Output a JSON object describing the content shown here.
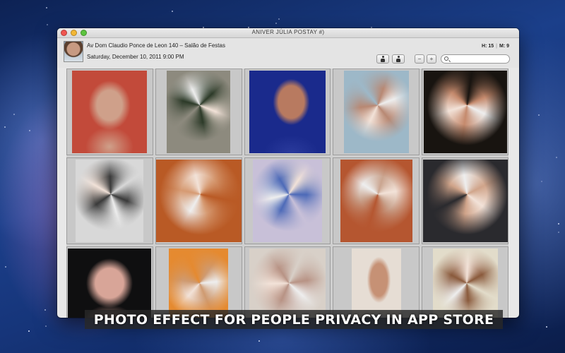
{
  "window": {
    "title": "ANIVER JÚLIA POSTAY #)"
  },
  "header": {
    "address": "Av Dom Claudio Ponce de Leon 140 – Salão de Festas",
    "date": "Saturday, December 10, 2011 9:00 PM",
    "h_count": "H: 15",
    "m_count": "M: 9",
    "separator": "|",
    "minus_label": "−",
    "plus_label": "+",
    "search_value": ""
  },
  "banner": {
    "text": "PHOTO EFFECT FOR PEOPLE PRIVACY IN APP STORE"
  },
  "photos": [
    {
      "style": "blur-face",
      "bg": "#c24a3a",
      "skin": "#cfa08a"
    },
    {
      "style": "swirl",
      "bg": "#8d8a7e",
      "skin": "#2c3a28"
    },
    {
      "style": "clear",
      "bg": "#1a2a8c",
      "skin": "#b87a60"
    },
    {
      "style": "swirl",
      "bg": "#9db8c8",
      "skin": "#b88873"
    },
    {
      "style": "swirl",
      "bg": "#181410",
      "skin": "#c58a6d"
    },
    {
      "style": "swirl",
      "bg": "#d8d8d8",
      "skin": "#3a3a3a"
    },
    {
      "style": "swirl",
      "bg": "#b95a25",
      "skin": "#d69a72"
    },
    {
      "style": "swirl",
      "bg": "#c8c0d8",
      "skin": "#4d6ab8"
    },
    {
      "style": "swirl",
      "bg": "#b55630",
      "skin": "#caa590"
    },
    {
      "style": "swirl",
      "bg": "#2a2a2e",
      "skin": "#d0a48a"
    },
    {
      "style": "blur-face",
      "bg": "#0f0f10",
      "skin": "#d8a598"
    },
    {
      "style": "swirl",
      "bg": "#e58a30",
      "skin": "#cf9a70"
    },
    {
      "style": "swirl",
      "bg": "#d8d0c8",
      "skin": "#b89385"
    },
    {
      "style": "clear",
      "bg": "#e6ddd4",
      "skin": "#c69175"
    },
    {
      "style": "swirl",
      "bg": "#e2dcca",
      "skin": "#8a5a3c"
    }
  ]
}
